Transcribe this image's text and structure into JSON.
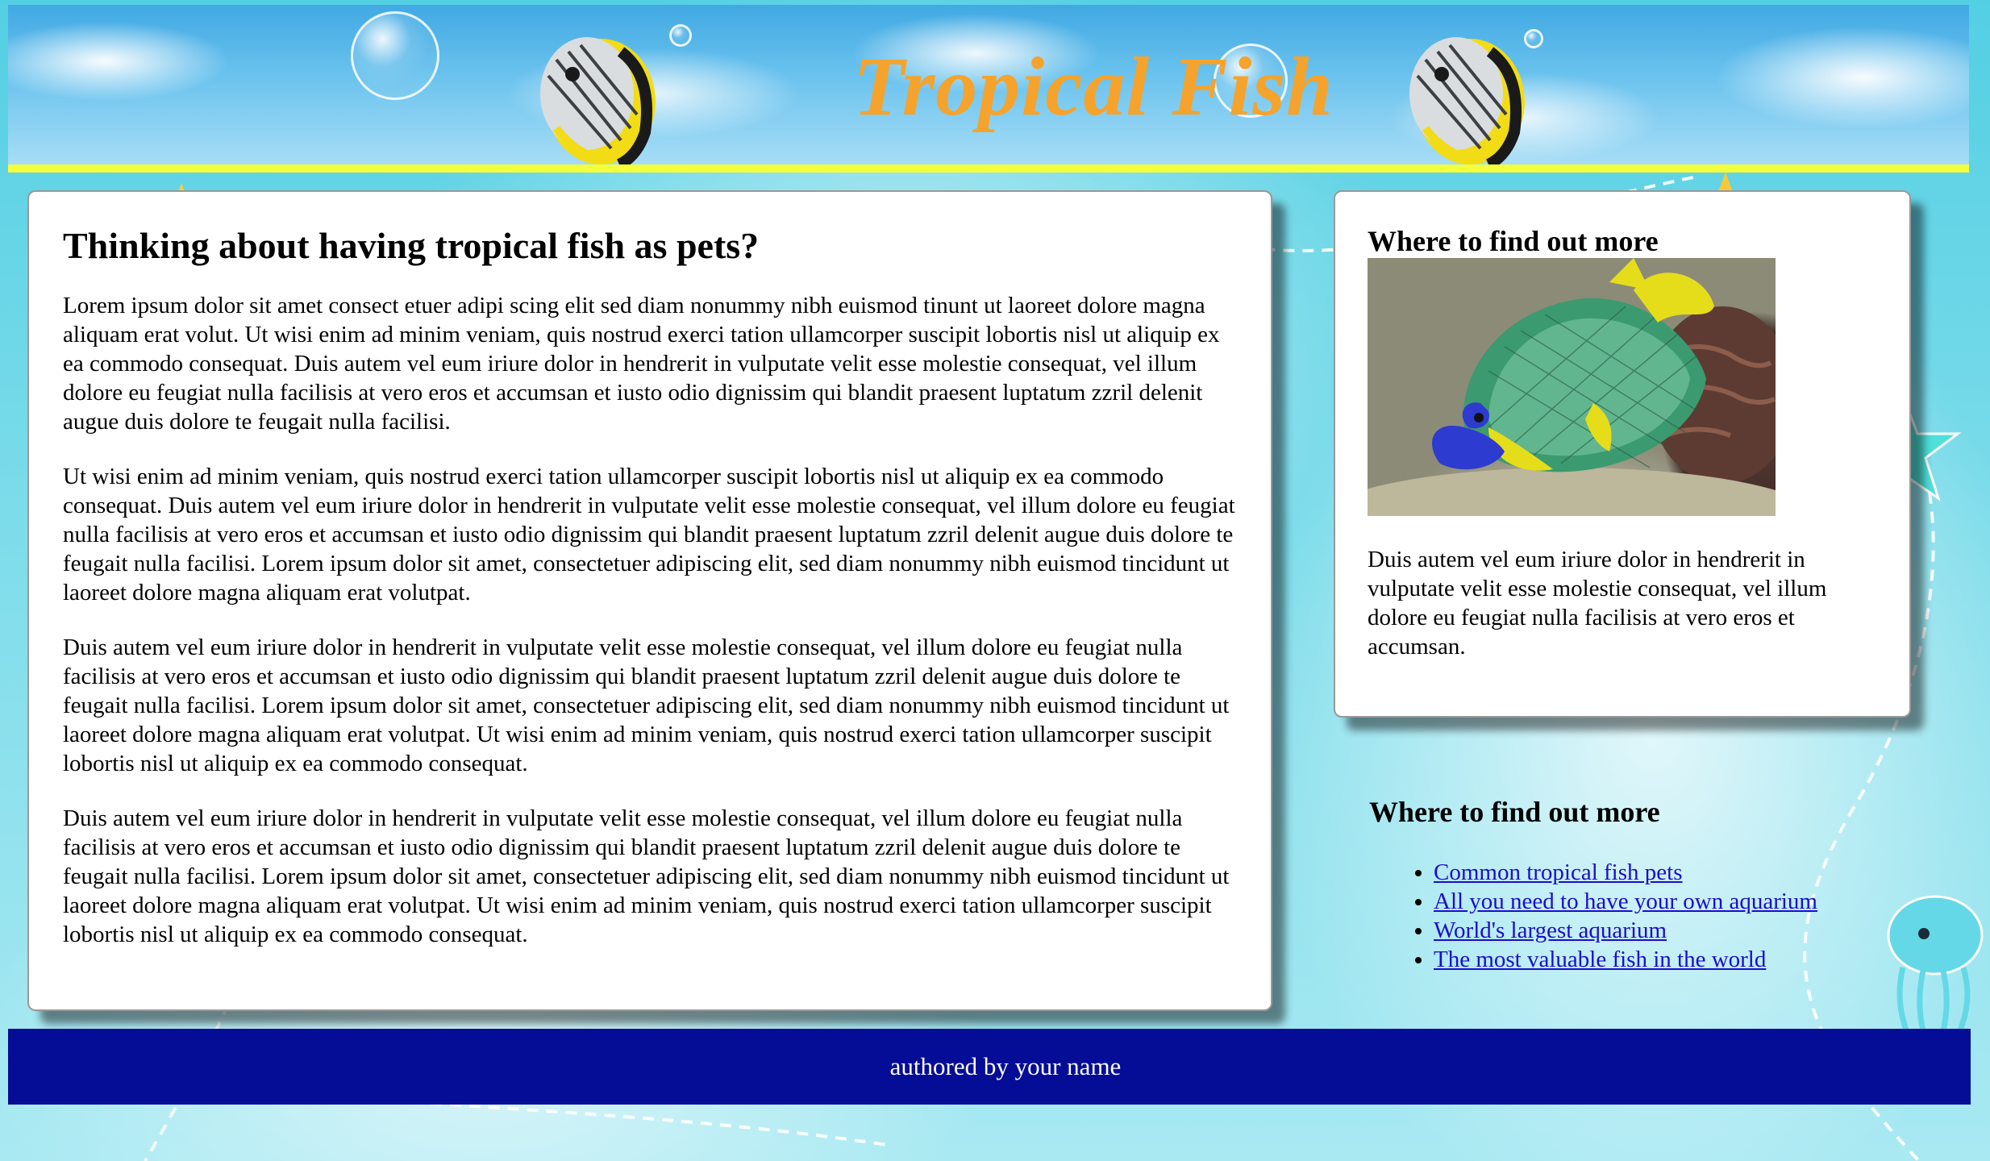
{
  "header": {
    "title": "Tropical Fish"
  },
  "main": {
    "heading": "Thinking about having tropical fish as pets?",
    "paragraphs": [
      "Lorem ipsum dolor sit amet consect etuer adipi scing elit sed diam nonummy nibh euismod tinunt ut laoreet dolore magna aliquam erat volut. Ut wisi enim ad minim veniam, quis nostrud exerci tation ullamcorper suscipit lobortis nisl ut aliquip ex ea commodo consequat. Duis autem vel eum iriure dolor in hendrerit in vulputate velit esse molestie consequat, vel illum dolore eu feugiat nulla facilisis at vero eros et accumsan et iusto odio dignissim qui blandit praesent luptatum zzril delenit augue duis dolore te feugait nulla facilisi.",
      "Ut wisi enim ad minim veniam, quis nostrud exerci tation ullamcorper suscipit lobortis nisl ut aliquip ex ea commodo consequat. Duis autem vel eum iriure dolor in hendrerit in vulputate velit esse molestie consequat, vel illum dolore eu feugiat nulla facilisis at vero eros et accumsan et iusto odio dignissim qui blandit praesent luptatum zzril delenit augue duis dolore te feugait nulla facilisi. Lorem ipsum dolor sit amet, consectetuer adipiscing elit, sed diam nonummy nibh euismod tincidunt ut laoreet dolore magna aliquam erat volutpat.",
      "Duis autem vel eum iriure dolor in hendrerit in vulputate velit esse molestie consequat, vel illum dolore eu feugiat nulla facilisis at vero eros et accumsan et iusto odio dignissim qui blandit praesent luptatum zzril delenit augue duis dolore te feugait nulla facilisi. Lorem ipsum dolor sit amet, consectetuer adipiscing elit, sed diam nonummy nibh euismod tincidunt ut laoreet dolore magna aliquam erat volutpat. Ut wisi enim ad minim veniam, quis nostrud exerci tation ullamcorper suscipit lobortis nisl ut aliquip ex ea commodo consequat.",
      "Duis autem vel eum iriure dolor in hendrerit in vulputate velit esse molestie consequat, vel illum dolore eu feugiat nulla facilisis at vero eros et accumsan et iusto odio dignissim qui blandit praesent luptatum zzril delenit augue duis dolore te feugait nulla facilisi. Lorem ipsum dolor sit amet, consectetuer adipiscing elit, sed diam nonummy nibh euismod tincidunt ut laoreet dolore magna aliquam erat volutpat. Ut wisi enim ad minim veniam, quis nostrud exerci tation ullamcorper suscipit lobortis nisl ut aliquip ex ea commodo consequat."
    ]
  },
  "side": {
    "heading": "Where to find out more",
    "text": "Duis autem vel eum iriure dolor in hendrerit in vulputate velit esse molestie consequat, vel illum dolore eu feugiat nulla facilisis at vero eros et accumsan."
  },
  "links": {
    "heading": "Where to find out more",
    "items": [
      "Common tropical fish pets",
      "All you need to have your own aquarium",
      "World's largest aquarium",
      "The most valuable fish in the world"
    ]
  },
  "footer": {
    "text": "authored by your name"
  },
  "colors": {
    "title": "#f5a32c",
    "header_strip": "#f4ff3c",
    "footer_bg": "#050d97",
    "link": "#1a0dcc"
  }
}
